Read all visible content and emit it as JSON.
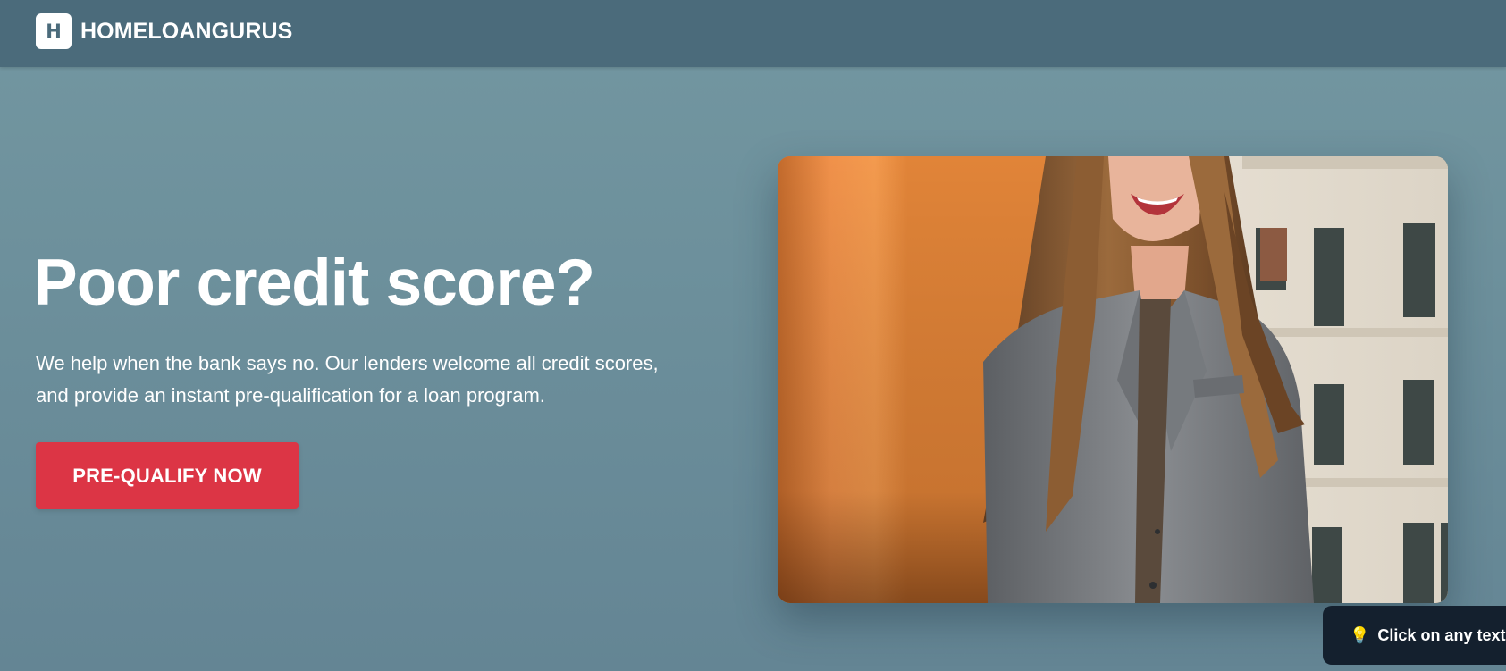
{
  "header": {
    "logo_letter": "H",
    "brand_name": "HOMELOANGURUS"
  },
  "hero": {
    "title": "Poor credit score?",
    "subtitle_line1": "We help when the bank says no. Our lenders welcome all credit scores,",
    "subtitle_line2": "and provide an instant pre-qualification for a loan program.",
    "cta_label": "PRE-QUALIFY NOW"
  },
  "image": {
    "subject": "smiling woman in grey blazer"
  },
  "tooltip": {
    "icon": "lightbulb-icon",
    "text": "Click on any text t"
  },
  "colors": {
    "header_bg": "#4b6b7b",
    "page_bg": "#6c8f9b",
    "cta_bg": "#dc3545",
    "tooltip_bg": "#14202e"
  }
}
